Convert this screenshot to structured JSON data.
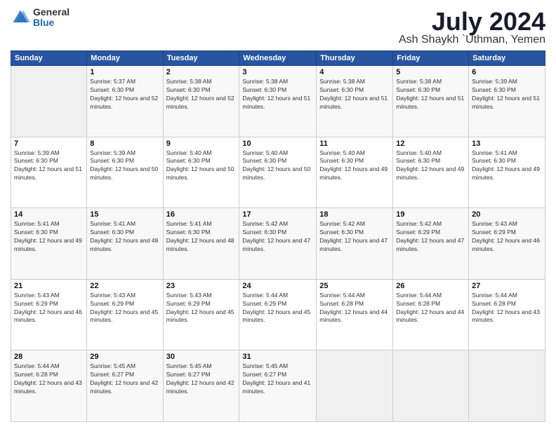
{
  "logo": {
    "general": "General",
    "blue": "Blue"
  },
  "header": {
    "month": "July 2024",
    "location": "Ash Shaykh `Uthman, Yemen"
  },
  "weekdays": [
    "Sunday",
    "Monday",
    "Tuesday",
    "Wednesday",
    "Thursday",
    "Friday",
    "Saturday"
  ],
  "weeks": [
    [
      {
        "day": null
      },
      {
        "day": "1",
        "sunrise": "5:37 AM",
        "sunset": "6:30 PM",
        "daylight": "12 hours and 52 minutes."
      },
      {
        "day": "2",
        "sunrise": "5:38 AM",
        "sunset": "6:30 PM",
        "daylight": "12 hours and 52 minutes."
      },
      {
        "day": "3",
        "sunrise": "5:38 AM",
        "sunset": "6:30 PM",
        "daylight": "12 hours and 51 minutes."
      },
      {
        "day": "4",
        "sunrise": "5:38 AM",
        "sunset": "6:30 PM",
        "daylight": "12 hours and 51 minutes."
      },
      {
        "day": "5",
        "sunrise": "5:38 AM",
        "sunset": "6:30 PM",
        "daylight": "12 hours and 51 minutes."
      },
      {
        "day": "6",
        "sunrise": "5:39 AM",
        "sunset": "6:30 PM",
        "daylight": "12 hours and 51 minutes."
      }
    ],
    [
      {
        "day": "7",
        "sunrise": "5:39 AM",
        "sunset": "6:30 PM",
        "daylight": "12 hours and 51 minutes."
      },
      {
        "day": "8",
        "sunrise": "5:39 AM",
        "sunset": "6:30 PM",
        "daylight": "12 hours and 50 minutes."
      },
      {
        "day": "9",
        "sunrise": "5:40 AM",
        "sunset": "6:30 PM",
        "daylight": "12 hours and 50 minutes."
      },
      {
        "day": "10",
        "sunrise": "5:40 AM",
        "sunset": "6:30 PM",
        "daylight": "12 hours and 50 minutes."
      },
      {
        "day": "11",
        "sunrise": "5:40 AM",
        "sunset": "6:30 PM",
        "daylight": "12 hours and 49 minutes."
      },
      {
        "day": "12",
        "sunrise": "5:40 AM",
        "sunset": "6:30 PM",
        "daylight": "12 hours and 49 minutes."
      },
      {
        "day": "13",
        "sunrise": "5:41 AM",
        "sunset": "6:30 PM",
        "daylight": "12 hours and 49 minutes."
      }
    ],
    [
      {
        "day": "14",
        "sunrise": "5:41 AM",
        "sunset": "6:30 PM",
        "daylight": "12 hours and 49 minutes."
      },
      {
        "day": "15",
        "sunrise": "5:41 AM",
        "sunset": "6:30 PM",
        "daylight": "12 hours and 48 minutes."
      },
      {
        "day": "16",
        "sunrise": "5:41 AM",
        "sunset": "6:30 PM",
        "daylight": "12 hours and 48 minutes."
      },
      {
        "day": "17",
        "sunrise": "5:42 AM",
        "sunset": "6:30 PM",
        "daylight": "12 hours and 47 minutes."
      },
      {
        "day": "18",
        "sunrise": "5:42 AM",
        "sunset": "6:30 PM",
        "daylight": "12 hours and 47 minutes."
      },
      {
        "day": "19",
        "sunrise": "5:42 AM",
        "sunset": "6:29 PM",
        "daylight": "12 hours and 47 minutes."
      },
      {
        "day": "20",
        "sunrise": "5:43 AM",
        "sunset": "6:29 PM",
        "daylight": "12 hours and 46 minutes."
      }
    ],
    [
      {
        "day": "21",
        "sunrise": "5:43 AM",
        "sunset": "6:29 PM",
        "daylight": "12 hours and 46 minutes."
      },
      {
        "day": "22",
        "sunrise": "5:43 AM",
        "sunset": "6:29 PM",
        "daylight": "12 hours and 45 minutes."
      },
      {
        "day": "23",
        "sunrise": "5:43 AM",
        "sunset": "6:29 PM",
        "daylight": "12 hours and 45 minutes."
      },
      {
        "day": "24",
        "sunrise": "5:44 AM",
        "sunset": "6:29 PM",
        "daylight": "12 hours and 45 minutes."
      },
      {
        "day": "25",
        "sunrise": "5:44 AM",
        "sunset": "6:28 PM",
        "daylight": "12 hours and 44 minutes."
      },
      {
        "day": "26",
        "sunrise": "5:44 AM",
        "sunset": "6:28 PM",
        "daylight": "12 hours and 44 minutes."
      },
      {
        "day": "27",
        "sunrise": "5:44 AM",
        "sunset": "6:28 PM",
        "daylight": "12 hours and 43 minutes."
      }
    ],
    [
      {
        "day": "28",
        "sunrise": "5:44 AM",
        "sunset": "6:28 PM",
        "daylight": "12 hours and 43 minutes."
      },
      {
        "day": "29",
        "sunrise": "5:45 AM",
        "sunset": "6:27 PM",
        "daylight": "12 hours and 42 minutes."
      },
      {
        "day": "30",
        "sunrise": "5:45 AM",
        "sunset": "6:27 PM",
        "daylight": "12 hours and 42 minutes."
      },
      {
        "day": "31",
        "sunrise": "5:45 AM",
        "sunset": "6:27 PM",
        "daylight": "12 hours and 41 minutes."
      },
      {
        "day": null
      },
      {
        "day": null
      },
      {
        "day": null
      }
    ]
  ]
}
